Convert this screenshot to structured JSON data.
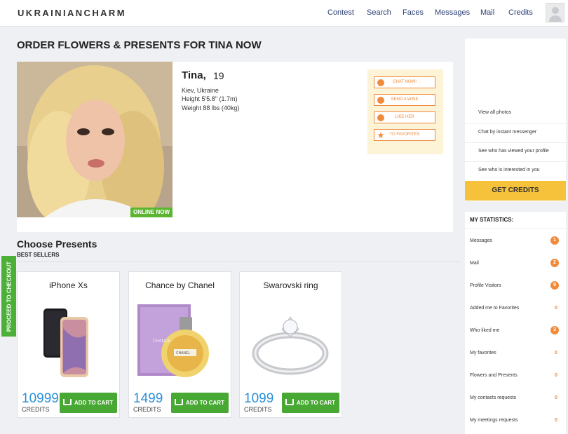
{
  "header": {
    "logo": "UKRAINIANCHARM",
    "nav": [
      "Contest",
      "Search",
      "Faces",
      "Messages",
      "Mail",
      "Credits"
    ]
  },
  "page_title": "ORDER FLOWERS & PRESENTS FOR TINA NOW",
  "profile": {
    "name": "Tina,",
    "age": "19",
    "location": "Kiev, Ukraine",
    "height": "Height 5'5.8\" (1.7m)",
    "weight": "Weight 88 lbs (40kg)",
    "status": "ONLINE NOW",
    "actions": [
      "CHAT NOW!",
      "SEND A WINK",
      "LIKE HER",
      "TO FAVORITES"
    ]
  },
  "presents": {
    "title": "Choose Presents",
    "subtitle": "BEST SELLERS",
    "items": [
      {
        "name": "iPhone Xs",
        "price": "10999",
        "unit": "CREDITS",
        "button": "ADD TO CART"
      },
      {
        "name": "Chance by Chanel",
        "price": "1499",
        "unit": "CREDITS",
        "button": "ADD TO CART"
      },
      {
        "name": "Swarovski ring",
        "price": "1099",
        "unit": "CREDITS",
        "button": "ADD TO CART"
      }
    ],
    "brand_on_box": "CHANCE",
    "brand_label": "CHANEL"
  },
  "checkout_label": "PROCEED TO CHECKOUT",
  "sidebar": {
    "links": [
      "View all photos",
      "Chat by instant messenger",
      "See who has viewed your profile",
      "See who is interested in you"
    ],
    "cta": "GET CREDITS"
  },
  "stats": {
    "title": "MY STATISTICS:",
    "rows": [
      {
        "label": "Messages",
        "value": "1"
      },
      {
        "label": "Mail",
        "value": "2"
      },
      {
        "label": "Profile Visitors",
        "value": "9"
      },
      {
        "label": "Added me to Favorites",
        "value": "0"
      },
      {
        "label": "Who liked me",
        "value": "3"
      },
      {
        "label": "My favorites",
        "value": "0"
      },
      {
        "label": "Flowers and Presents",
        "value": "0"
      },
      {
        "label": "My contacts requests",
        "value": "0"
      },
      {
        "label": "My meetings requests",
        "value": "0"
      }
    ]
  },
  "colors": {
    "accent": "#f08a3c",
    "cart": "#47a833",
    "price": "#2a8fd6",
    "cta": "#f7c23b",
    "nav": "#2b3f73"
  }
}
